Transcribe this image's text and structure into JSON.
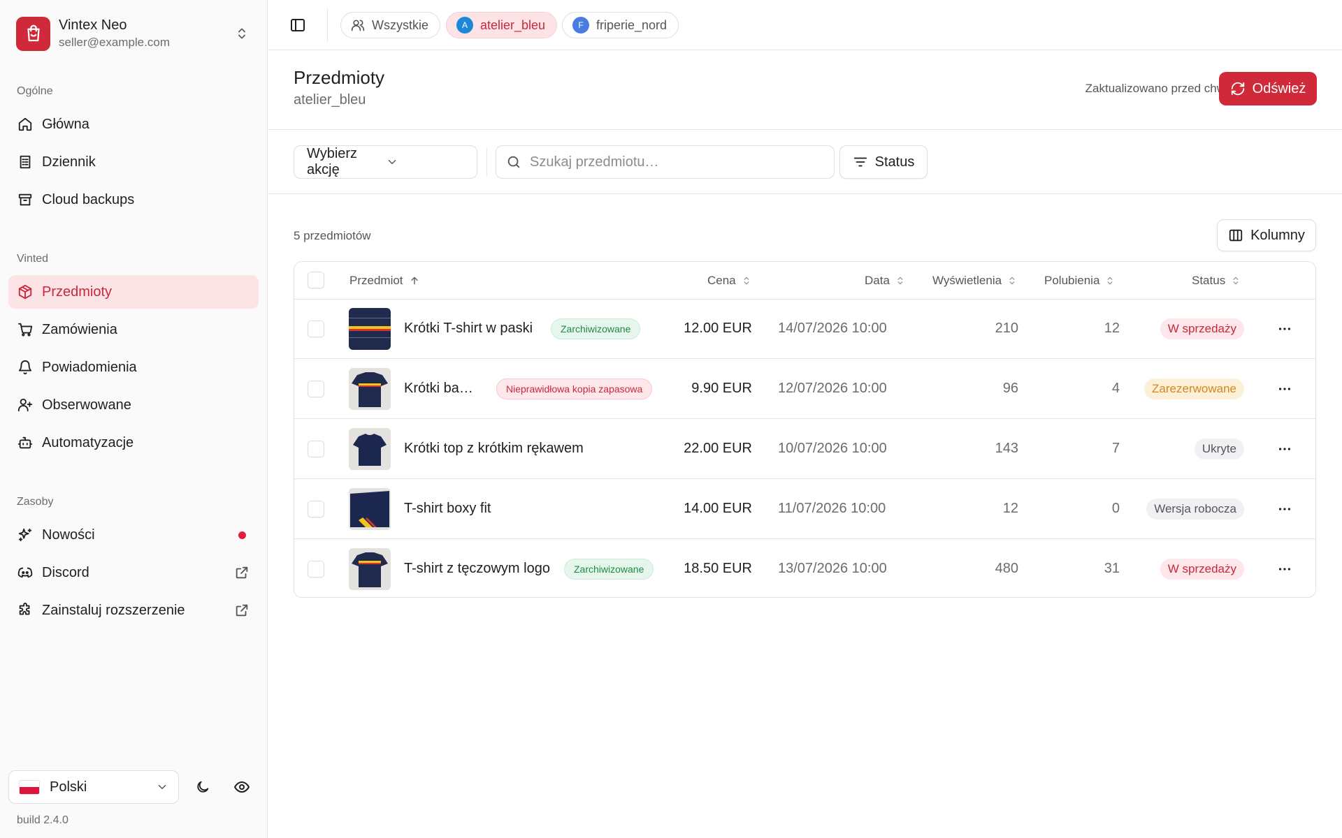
{
  "brand": {
    "name": "Vintex Neo",
    "email": "seller@example.com"
  },
  "sidebar": {
    "sections": [
      {
        "label": "Ogólne"
      },
      {
        "label": "Vinted"
      },
      {
        "label": "Zasoby"
      }
    ],
    "general": [
      {
        "label": "Główna",
        "icon": "home-icon"
      },
      {
        "label": "Dziennik",
        "icon": "logs-icon"
      },
      {
        "label": "Cloud backups",
        "icon": "archive-icon"
      }
    ],
    "vinted": [
      {
        "label": "Przedmioty",
        "icon": "package-icon",
        "active": true
      },
      {
        "label": "Zamówienia",
        "icon": "cart-icon"
      },
      {
        "label": "Powiadomienia",
        "icon": "bell-icon"
      },
      {
        "label": "Obserwowane",
        "icon": "user-plus-icon"
      },
      {
        "label": "Automatyzacje",
        "icon": "bot-icon"
      }
    ],
    "resources": [
      {
        "label": "Nowości",
        "icon": "sparkles-icon"
      },
      {
        "label": "Discord",
        "icon": "discord-icon"
      },
      {
        "label": "Zainstaluj rozszerzenie",
        "icon": "puzzle-icon"
      }
    ],
    "language": "Polski",
    "build": "build 2.4.0"
  },
  "topbar": {
    "accounts": [
      {
        "label": "Wszystkie"
      },
      {
        "label": "atelier_bleu",
        "initial": "A",
        "color": "#1e88d8",
        "active": true
      },
      {
        "label": "friperie_nord",
        "initial": "F",
        "color": "#4a7be0"
      }
    ]
  },
  "header": {
    "title": "Przedmioty",
    "subtitle": "atelier_bleu",
    "updated": "Zaktualizowano przed chwilą",
    "refresh_label": "Odśwież"
  },
  "toolbar": {
    "action_select": "Wybierz akcję",
    "search_placeholder": "Szukaj przedmiotu…",
    "status_label": "Status"
  },
  "content": {
    "count": "5 przedmiotów",
    "columns_label": "Kolumny"
  },
  "table": {
    "headers": {
      "item": "Przedmiot",
      "price": "Cena",
      "date": "Data",
      "views": "Wyświetlenia",
      "likes": "Polubienia",
      "status": "Status"
    },
    "rows": [
      {
        "name": "Krótki T-shirt w paski",
        "tag": "Zarchiwizowane",
        "price": "12.00 EUR",
        "date": "14/07/2026 10:00",
        "views": "210",
        "likes": "12",
        "status": "W sprzedaży"
      },
      {
        "name": "Krótki ba…",
        "tag": "Nieprawidłowa kopia zapasowa",
        "price": "9.90 EUR",
        "date": "12/07/2026 10:00",
        "views": "96",
        "likes": "4",
        "status": "Zarezerwowane"
      },
      {
        "name": "Krótki top z krótkim rękawem",
        "tag": "",
        "price": "22.00 EUR",
        "date": "10/07/2026 10:00",
        "views": "143",
        "likes": "7",
        "status": "Ukryte"
      },
      {
        "name": "T-shirt boxy fit",
        "tag": "",
        "price": "14.00 EUR",
        "date": "11/07/2026 10:00",
        "views": "12",
        "likes": "0",
        "status": "Wersja robocza"
      },
      {
        "name": "T-shirt z tęczowym logo",
        "tag": "Zarchiwizowane",
        "price": "18.50 EUR",
        "date": "13/07/2026 10:00",
        "views": "480",
        "likes": "31",
        "status": "W sprzedaży"
      }
    ]
  },
  "colors": {
    "accent": "#d02a3a",
    "accent_soft": "#fbe3e6"
  }
}
